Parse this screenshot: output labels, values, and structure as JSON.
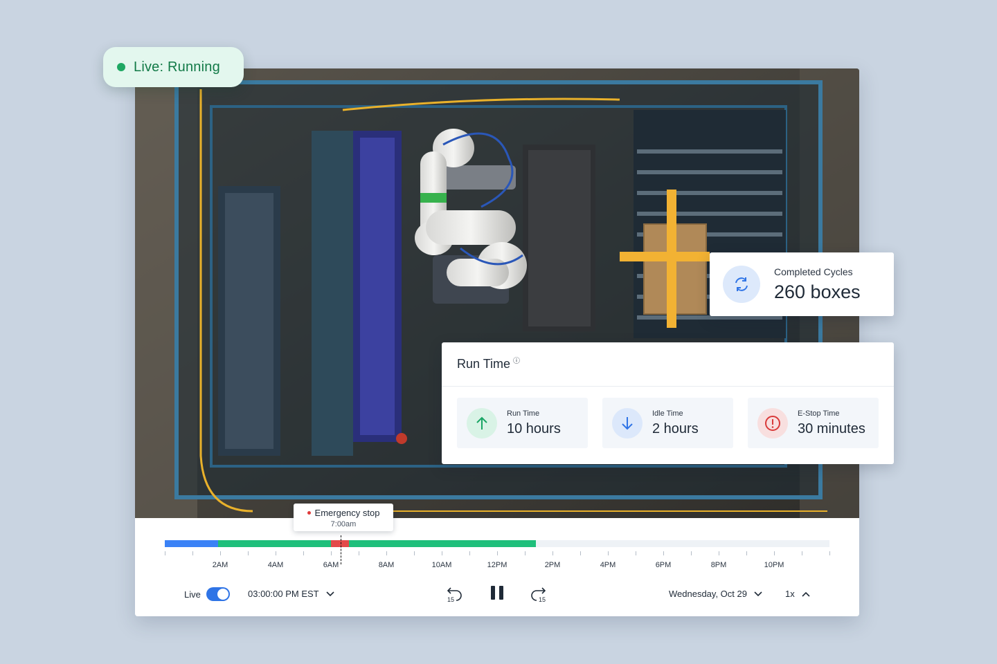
{
  "status_badge": {
    "label": "Live: Running",
    "color": "#1fa863"
  },
  "completed_cycles": {
    "label": "Completed Cycles",
    "value": "260 boxes",
    "icon": "refresh-icon"
  },
  "run_time_card": {
    "title": "Run Time",
    "metrics": [
      {
        "label": "Run Time",
        "value": "10 hours",
        "icon": "arrow-up-icon",
        "color": "#18a564"
      },
      {
        "label": "Idle Time",
        "value": "2 hours",
        "icon": "arrow-down-icon",
        "color": "#2f74e6"
      },
      {
        "label": "E-Stop Time",
        "value": "30 minutes",
        "icon": "alert-icon",
        "color": "#d93a3a"
      }
    ]
  },
  "timeline": {
    "tooltip": {
      "title": "Emergency stop",
      "time": "7:00am"
    },
    "hour_labels": [
      "2AM",
      "4AM",
      "6AM",
      "8AM",
      "10AM",
      "12PM",
      "2PM",
      "4PM",
      "6PM",
      "8PM",
      "10PM"
    ],
    "segment_colors": {
      "idle": "#3b82f6",
      "run": "#1fbf7b",
      "estop": "#e34a4a",
      "empty": "#eef2f6"
    }
  },
  "controls": {
    "live_label": "Live",
    "live_on": true,
    "time": "03:00:00 PM EST",
    "rewind_label": "15",
    "forward_label": "15",
    "date": "Wednesday, Oct 29",
    "speed": "1x"
  }
}
